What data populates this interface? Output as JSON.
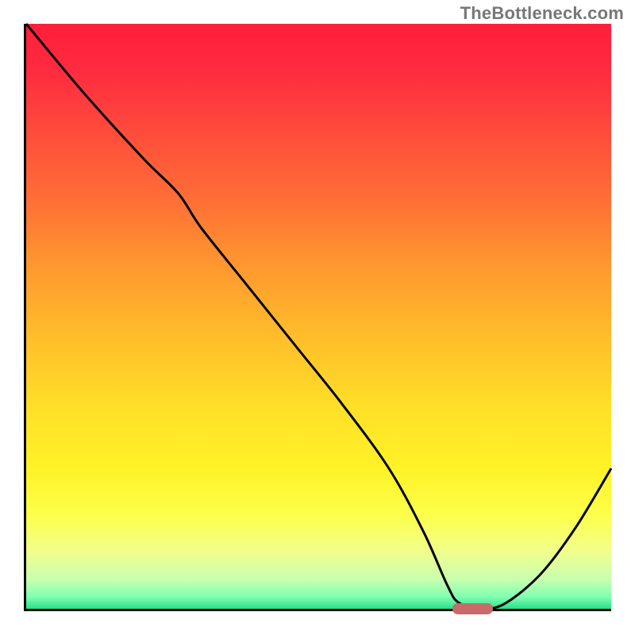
{
  "watermark": "TheBottleneck.com",
  "colors": {
    "axis": "#000000",
    "curve": "#000000",
    "marker": "#c96a6a",
    "gradient_top": "#ff1f3c",
    "gradient_bottom": "#27e08a",
    "watermark": "#777777"
  },
  "chart_data": {
    "type": "line",
    "title": "",
    "xlabel": "",
    "ylabel": "",
    "xlim": [
      0,
      100
    ],
    "ylim": [
      0,
      100
    ],
    "grid": false,
    "legend": false,
    "curve": {
      "name": "bottleneck-curve",
      "x": [
        0,
        10,
        20,
        26,
        30,
        38,
        46,
        54,
        62,
        68,
        72,
        74,
        78,
        82,
        88,
        94,
        100
      ],
      "y": [
        100,
        88,
        77,
        71,
        65,
        55,
        45,
        35,
        24,
        13,
        4,
        1,
        0,
        1,
        6,
        14,
        24
      ]
    },
    "marker": {
      "name": "optimal-spot",
      "x_center": 76,
      "y": 0,
      "width_pct": 7
    },
    "background": {
      "type": "vertical-gradient",
      "meaning": "red=bad, green=good",
      "stops": [
        {
          "pct": 0,
          "color": "#ff1f3c"
        },
        {
          "pct": 50,
          "color": "#ffbf2a"
        },
        {
          "pct": 85,
          "color": "#fcff4a"
        },
        {
          "pct": 100,
          "color": "#27e08a"
        }
      ]
    }
  }
}
